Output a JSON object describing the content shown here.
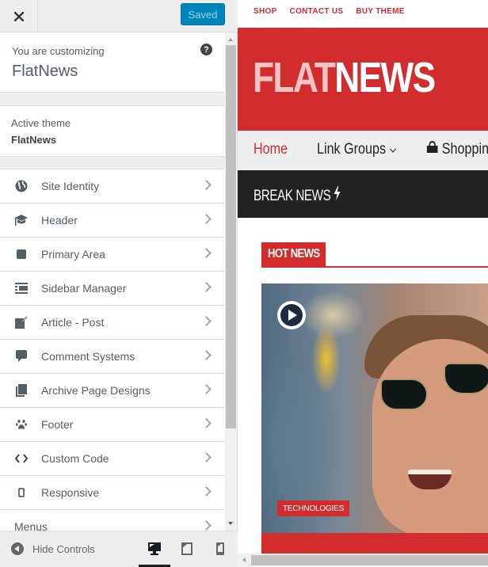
{
  "customizer": {
    "close_label": "×",
    "save_label": "Saved",
    "info": {
      "label": "You are customizing",
      "title": "FlatNews",
      "help_icon": "?"
    },
    "active_theme": {
      "label": "Active theme",
      "name": "FlatNews"
    },
    "sections": [
      {
        "label": "Site Identity",
        "icon": "globe-icon"
      },
      {
        "label": "Header",
        "icon": "graduation-cap-icon"
      },
      {
        "label": "Primary Area",
        "icon": "square-icon"
      },
      {
        "label": "Sidebar Manager",
        "icon": "list-indent-icon"
      },
      {
        "label": "Article - Post",
        "icon": "edit-icon"
      },
      {
        "label": "Comment Systems",
        "icon": "comment-icon"
      },
      {
        "label": "Archive Page Designs",
        "icon": "copy-icon"
      },
      {
        "label": "Footer",
        "icon": "paw-icon"
      },
      {
        "label": "Custom Code",
        "icon": "code-icon"
      },
      {
        "label": "Responsive",
        "icon": "mobile-icon"
      },
      {
        "label": "Menus",
        "icon": ""
      }
    ],
    "footer": {
      "hide_controls_label": "Hide Controls",
      "devices": [
        {
          "name": "desktop",
          "active": true
        },
        {
          "name": "tablet",
          "active": false
        },
        {
          "name": "mobile",
          "active": false
        }
      ]
    }
  },
  "preview": {
    "top_links": [
      "SHOP",
      "CONTACT US",
      "BUY THEME"
    ],
    "logo": {
      "part1": "FLAT",
      "part2": "NEWS"
    },
    "nav": {
      "home": "Home",
      "link_groups": "Link Groups",
      "shopping": "Shoppin"
    },
    "break_news": "BREAK NEWS",
    "hot_news": "HOT NEWS",
    "featured": {
      "category": "TECHNOLOGIES"
    },
    "colors": {
      "brand_red": "#d32c2c",
      "dark_bar": "#222222",
      "save_blue": "#0085ba"
    }
  }
}
